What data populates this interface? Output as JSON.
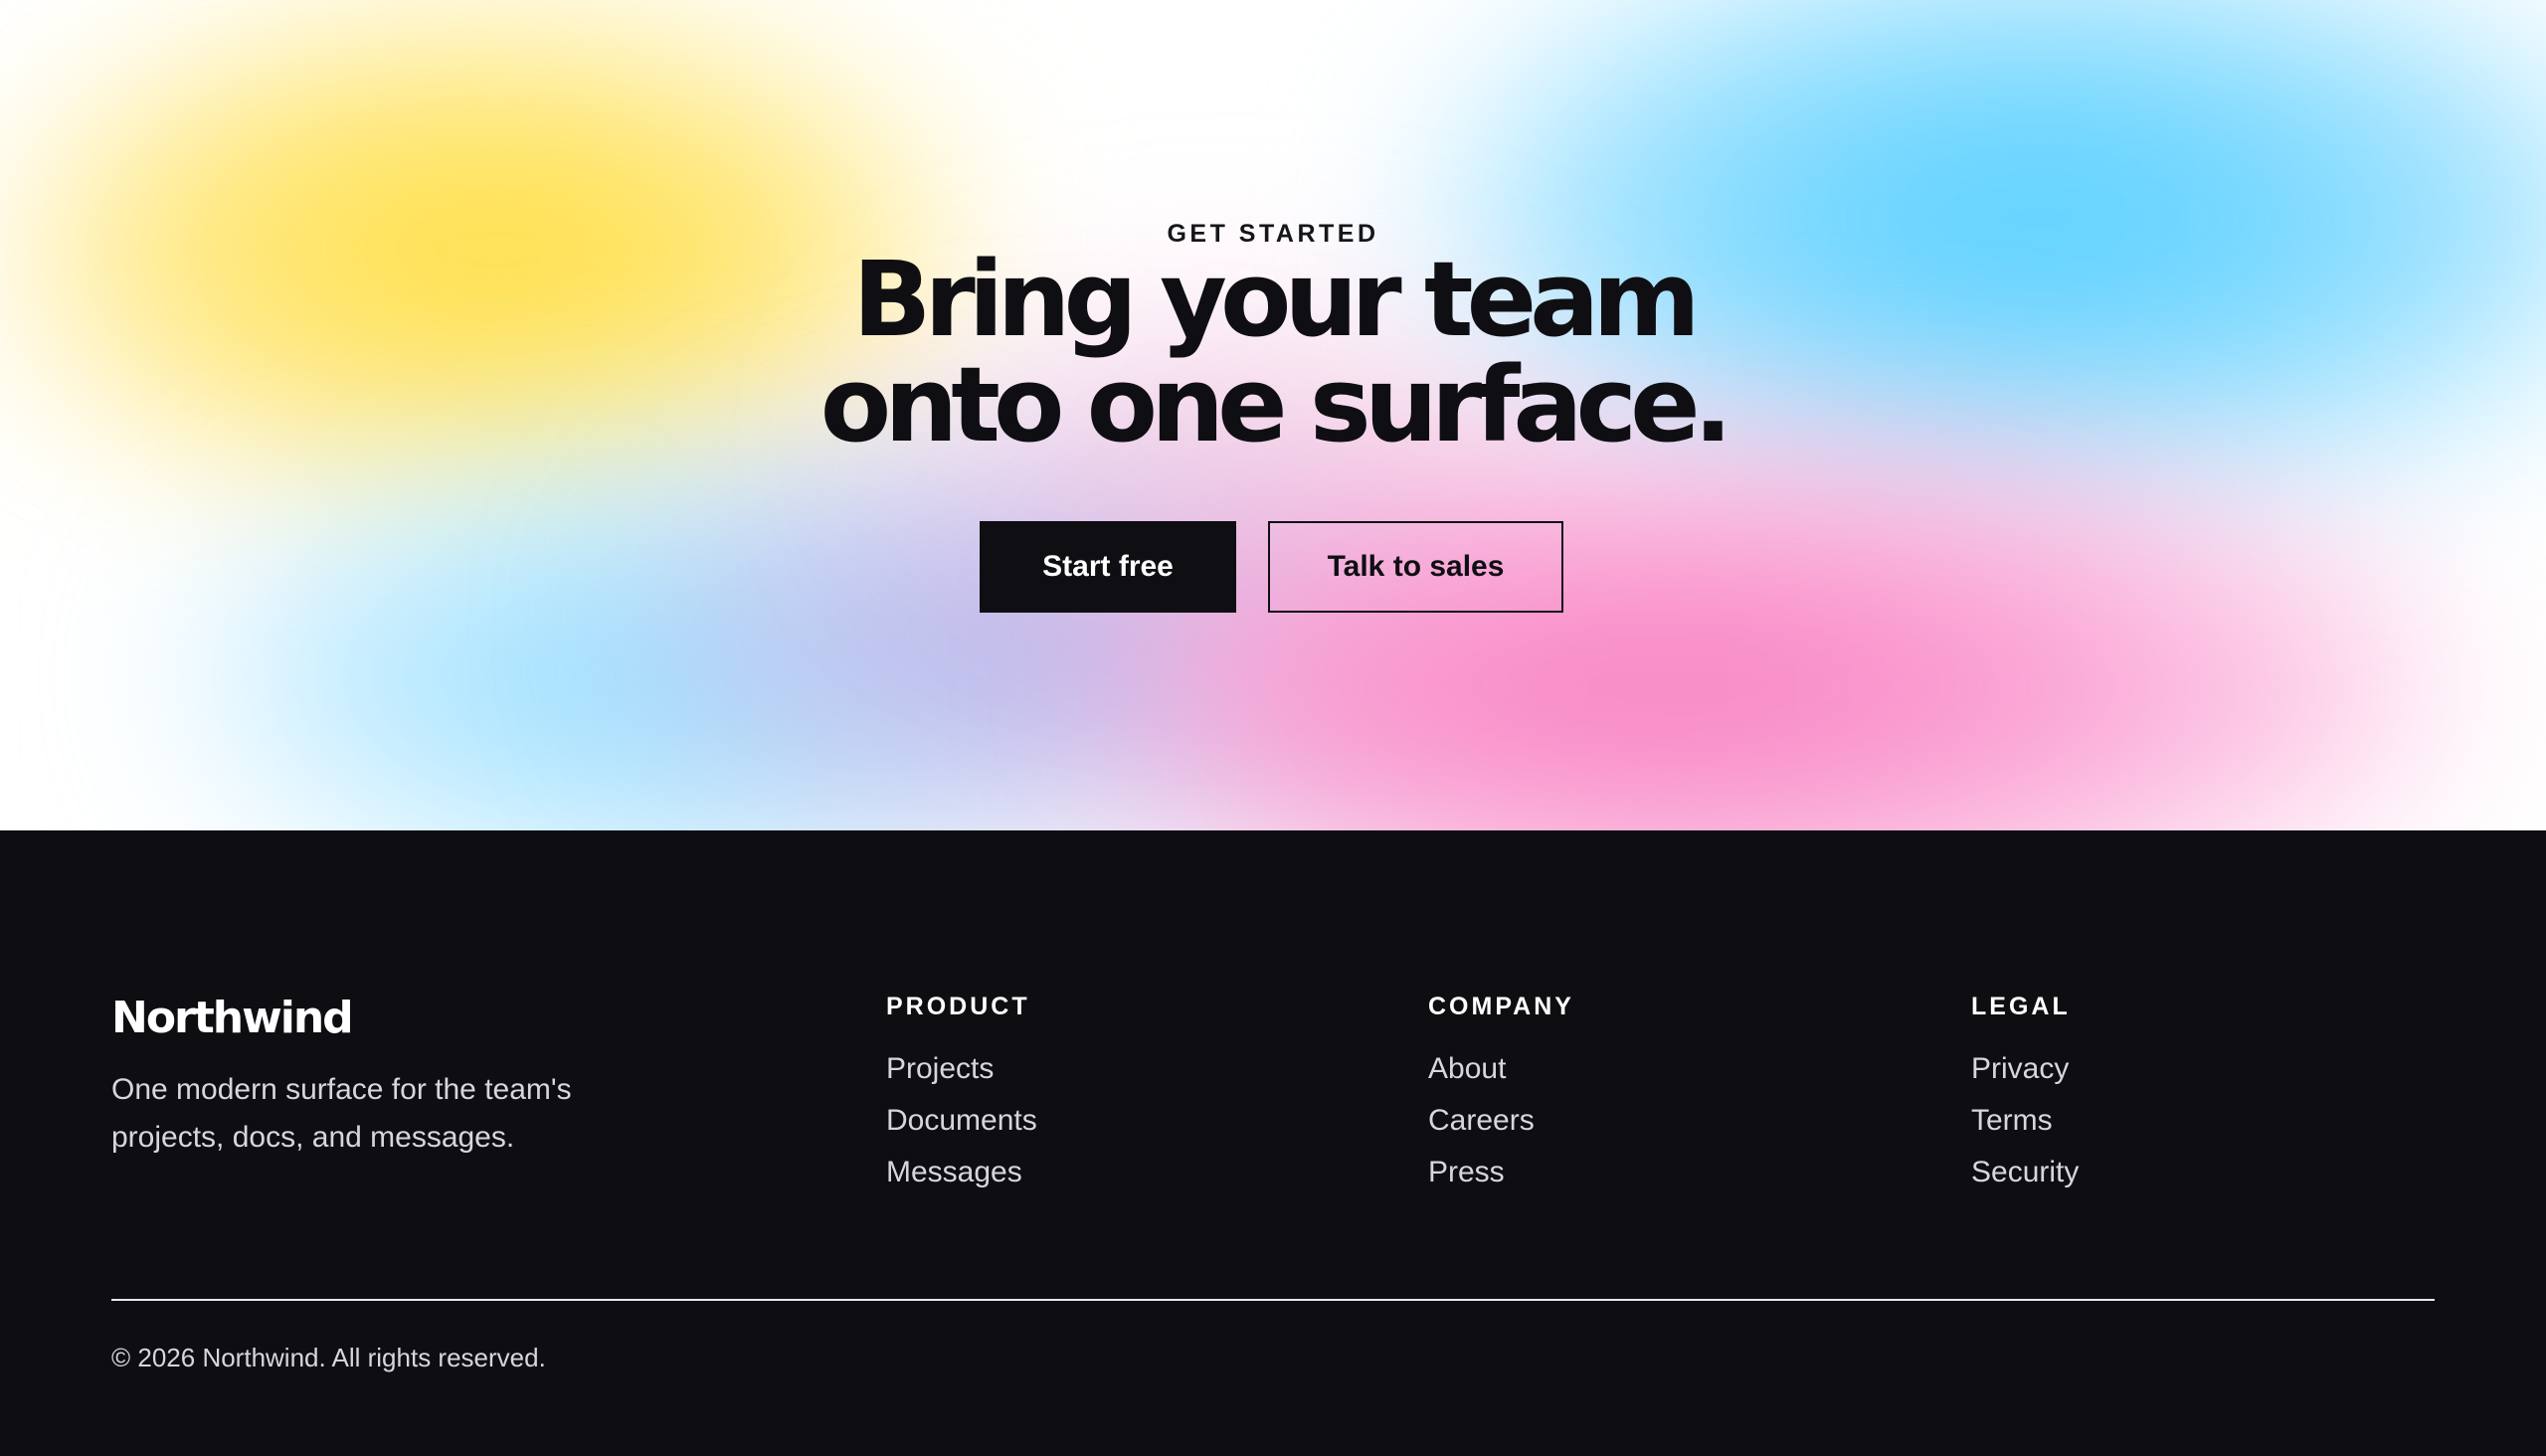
{
  "hero": {
    "eyebrow": "GET STARTED",
    "headline_line1": "Bring your team",
    "headline_line2": "onto one surface.",
    "primary_cta": "Start free",
    "secondary_cta": "Talk to sales",
    "gradient_colors": {
      "yellow": "#ffde3a",
      "blue": "#4fcfff",
      "pink": "#f779bd",
      "lavender": "#aaa0e6"
    }
  },
  "footer": {
    "brand": "Northwind",
    "tagline": "One modern surface for the team's projects, docs, and messages.",
    "columns": [
      {
        "title": "PRODUCT",
        "links": [
          "Projects",
          "Documents",
          "Messages"
        ]
      },
      {
        "title": "COMPANY",
        "links": [
          "About",
          "Careers",
          "Press"
        ]
      },
      {
        "title": "LEGAL",
        "links": [
          "Privacy",
          "Terms",
          "Security"
        ]
      }
    ],
    "copyright": "© 2026 Northwind. All rights reserved.",
    "background": "#0e0e12"
  }
}
